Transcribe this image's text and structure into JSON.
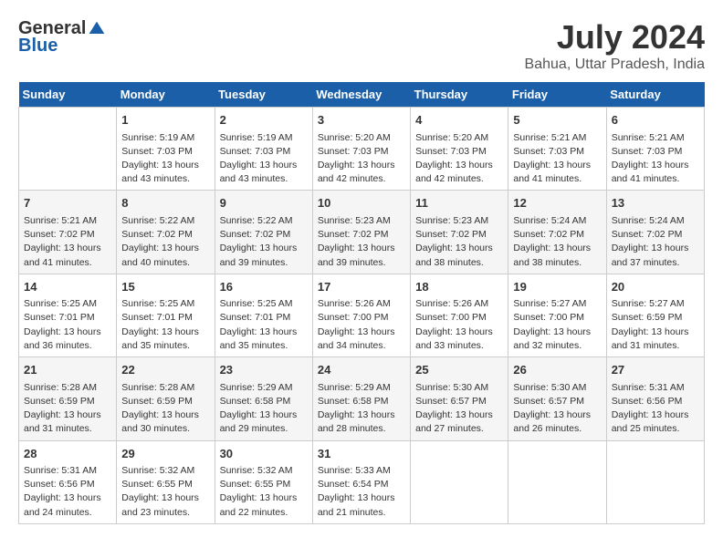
{
  "header": {
    "logo_general": "General",
    "logo_blue": "Blue",
    "title": "July 2024",
    "location": "Bahua, Uttar Pradesh, India"
  },
  "days_of_week": [
    "Sunday",
    "Monday",
    "Tuesday",
    "Wednesday",
    "Thursday",
    "Friday",
    "Saturday"
  ],
  "weeks": [
    [
      {
        "num": "",
        "sunrise": "",
        "sunset": "",
        "daylight": ""
      },
      {
        "num": "1",
        "sunrise": "Sunrise: 5:19 AM",
        "sunset": "Sunset: 7:03 PM",
        "daylight": "Daylight: 13 hours and 43 minutes."
      },
      {
        "num": "2",
        "sunrise": "Sunrise: 5:19 AM",
        "sunset": "Sunset: 7:03 PM",
        "daylight": "Daylight: 13 hours and 43 minutes."
      },
      {
        "num": "3",
        "sunrise": "Sunrise: 5:20 AM",
        "sunset": "Sunset: 7:03 PM",
        "daylight": "Daylight: 13 hours and 42 minutes."
      },
      {
        "num": "4",
        "sunrise": "Sunrise: 5:20 AM",
        "sunset": "Sunset: 7:03 PM",
        "daylight": "Daylight: 13 hours and 42 minutes."
      },
      {
        "num": "5",
        "sunrise": "Sunrise: 5:21 AM",
        "sunset": "Sunset: 7:03 PM",
        "daylight": "Daylight: 13 hours and 41 minutes."
      },
      {
        "num": "6",
        "sunrise": "Sunrise: 5:21 AM",
        "sunset": "Sunset: 7:03 PM",
        "daylight": "Daylight: 13 hours and 41 minutes."
      }
    ],
    [
      {
        "num": "7",
        "sunrise": "Sunrise: 5:21 AM",
        "sunset": "Sunset: 7:02 PM",
        "daylight": "Daylight: 13 hours and 41 minutes."
      },
      {
        "num": "8",
        "sunrise": "Sunrise: 5:22 AM",
        "sunset": "Sunset: 7:02 PM",
        "daylight": "Daylight: 13 hours and 40 minutes."
      },
      {
        "num": "9",
        "sunrise": "Sunrise: 5:22 AM",
        "sunset": "Sunset: 7:02 PM",
        "daylight": "Daylight: 13 hours and 39 minutes."
      },
      {
        "num": "10",
        "sunrise": "Sunrise: 5:23 AM",
        "sunset": "Sunset: 7:02 PM",
        "daylight": "Daylight: 13 hours and 39 minutes."
      },
      {
        "num": "11",
        "sunrise": "Sunrise: 5:23 AM",
        "sunset": "Sunset: 7:02 PM",
        "daylight": "Daylight: 13 hours and 38 minutes."
      },
      {
        "num": "12",
        "sunrise": "Sunrise: 5:24 AM",
        "sunset": "Sunset: 7:02 PM",
        "daylight": "Daylight: 13 hours and 38 minutes."
      },
      {
        "num": "13",
        "sunrise": "Sunrise: 5:24 AM",
        "sunset": "Sunset: 7:02 PM",
        "daylight": "Daylight: 13 hours and 37 minutes."
      }
    ],
    [
      {
        "num": "14",
        "sunrise": "Sunrise: 5:25 AM",
        "sunset": "Sunset: 7:01 PM",
        "daylight": "Daylight: 13 hours and 36 minutes."
      },
      {
        "num": "15",
        "sunrise": "Sunrise: 5:25 AM",
        "sunset": "Sunset: 7:01 PM",
        "daylight": "Daylight: 13 hours and 35 minutes."
      },
      {
        "num": "16",
        "sunrise": "Sunrise: 5:25 AM",
        "sunset": "Sunset: 7:01 PM",
        "daylight": "Daylight: 13 hours and 35 minutes."
      },
      {
        "num": "17",
        "sunrise": "Sunrise: 5:26 AM",
        "sunset": "Sunset: 7:00 PM",
        "daylight": "Daylight: 13 hours and 34 minutes."
      },
      {
        "num": "18",
        "sunrise": "Sunrise: 5:26 AM",
        "sunset": "Sunset: 7:00 PM",
        "daylight": "Daylight: 13 hours and 33 minutes."
      },
      {
        "num": "19",
        "sunrise": "Sunrise: 5:27 AM",
        "sunset": "Sunset: 7:00 PM",
        "daylight": "Daylight: 13 hours and 32 minutes."
      },
      {
        "num": "20",
        "sunrise": "Sunrise: 5:27 AM",
        "sunset": "Sunset: 6:59 PM",
        "daylight": "Daylight: 13 hours and 31 minutes."
      }
    ],
    [
      {
        "num": "21",
        "sunrise": "Sunrise: 5:28 AM",
        "sunset": "Sunset: 6:59 PM",
        "daylight": "Daylight: 13 hours and 31 minutes."
      },
      {
        "num": "22",
        "sunrise": "Sunrise: 5:28 AM",
        "sunset": "Sunset: 6:59 PM",
        "daylight": "Daylight: 13 hours and 30 minutes."
      },
      {
        "num": "23",
        "sunrise": "Sunrise: 5:29 AM",
        "sunset": "Sunset: 6:58 PM",
        "daylight": "Daylight: 13 hours and 29 minutes."
      },
      {
        "num": "24",
        "sunrise": "Sunrise: 5:29 AM",
        "sunset": "Sunset: 6:58 PM",
        "daylight": "Daylight: 13 hours and 28 minutes."
      },
      {
        "num": "25",
        "sunrise": "Sunrise: 5:30 AM",
        "sunset": "Sunset: 6:57 PM",
        "daylight": "Daylight: 13 hours and 27 minutes."
      },
      {
        "num": "26",
        "sunrise": "Sunrise: 5:30 AM",
        "sunset": "Sunset: 6:57 PM",
        "daylight": "Daylight: 13 hours and 26 minutes."
      },
      {
        "num": "27",
        "sunrise": "Sunrise: 5:31 AM",
        "sunset": "Sunset: 6:56 PM",
        "daylight": "Daylight: 13 hours and 25 minutes."
      }
    ],
    [
      {
        "num": "28",
        "sunrise": "Sunrise: 5:31 AM",
        "sunset": "Sunset: 6:56 PM",
        "daylight": "Daylight: 13 hours and 24 minutes."
      },
      {
        "num": "29",
        "sunrise": "Sunrise: 5:32 AM",
        "sunset": "Sunset: 6:55 PM",
        "daylight": "Daylight: 13 hours and 23 minutes."
      },
      {
        "num": "30",
        "sunrise": "Sunrise: 5:32 AM",
        "sunset": "Sunset: 6:55 PM",
        "daylight": "Daylight: 13 hours and 22 minutes."
      },
      {
        "num": "31",
        "sunrise": "Sunrise: 5:33 AM",
        "sunset": "Sunset: 6:54 PM",
        "daylight": "Daylight: 13 hours and 21 minutes."
      },
      {
        "num": "",
        "sunrise": "",
        "sunset": "",
        "daylight": ""
      },
      {
        "num": "",
        "sunrise": "",
        "sunset": "",
        "daylight": ""
      },
      {
        "num": "",
        "sunrise": "",
        "sunset": "",
        "daylight": ""
      }
    ]
  ]
}
